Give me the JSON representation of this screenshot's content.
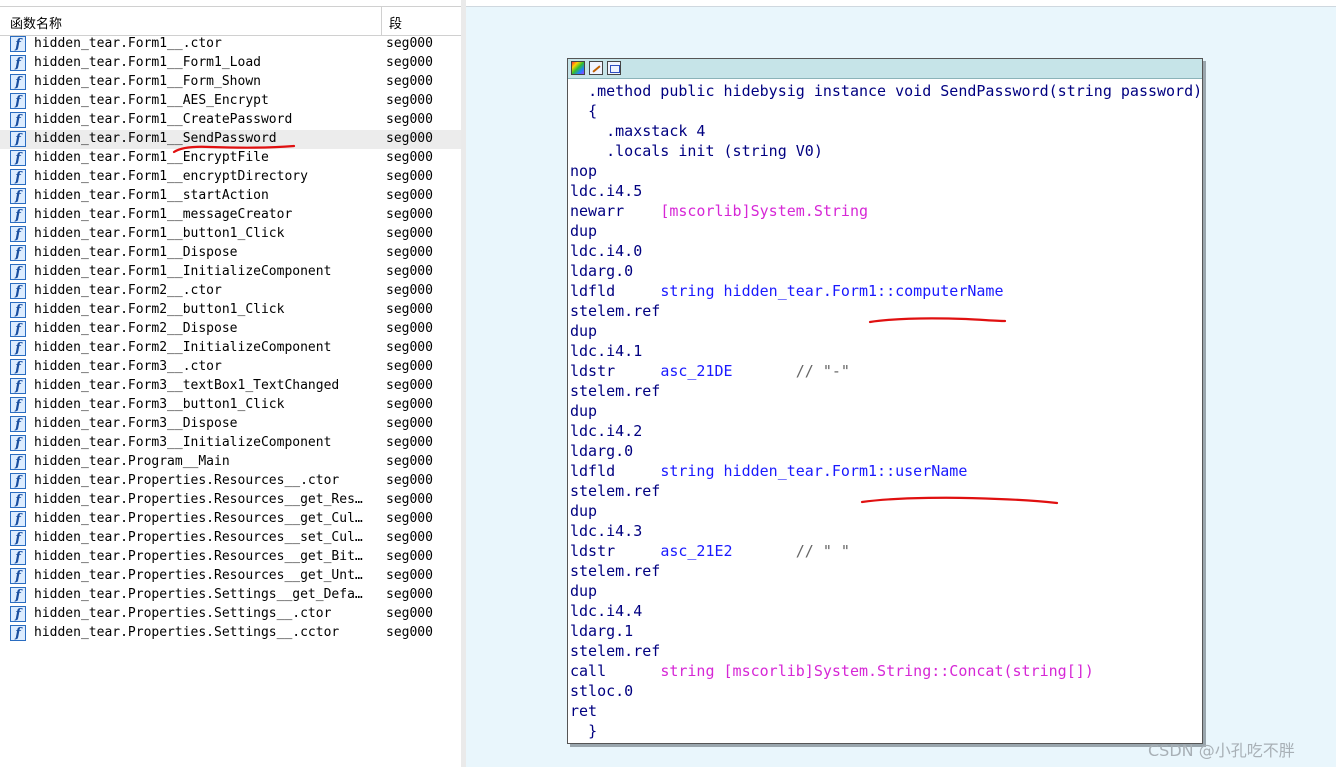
{
  "function_list": {
    "header": {
      "name_col": "函数名称",
      "segment_col": "段"
    },
    "icon_glyph": "f",
    "rows": [
      {
        "name": "hidden_tear.Form1__.ctor",
        "segment": "seg000"
      },
      {
        "name": "hidden_tear.Form1__Form1_Load",
        "segment": "seg000"
      },
      {
        "name": "hidden_tear.Form1__Form_Shown",
        "segment": "seg000"
      },
      {
        "name": "hidden_tear.Form1__AES_Encrypt",
        "segment": "seg000"
      },
      {
        "name": "hidden_tear.Form1__CreatePassword",
        "segment": "seg000"
      },
      {
        "name": "hidden_tear.Form1__SendPassword",
        "segment": "seg000",
        "selected": true
      },
      {
        "name": "hidden_tear.Form1__EncryptFile",
        "segment": "seg000"
      },
      {
        "name": "hidden_tear.Form1__encryptDirectory",
        "segment": "seg000"
      },
      {
        "name": "hidden_tear.Form1__startAction",
        "segment": "seg000"
      },
      {
        "name": "hidden_tear.Form1__messageCreator",
        "segment": "seg000"
      },
      {
        "name": "hidden_tear.Form1__button1_Click",
        "segment": "seg000"
      },
      {
        "name": "hidden_tear.Form1__Dispose",
        "segment": "seg000"
      },
      {
        "name": "hidden_tear.Form1__InitializeComponent",
        "segment": "seg000"
      },
      {
        "name": "hidden_tear.Form2__.ctor",
        "segment": "seg000"
      },
      {
        "name": "hidden_tear.Form2__button1_Click",
        "segment": "seg000"
      },
      {
        "name": "hidden_tear.Form2__Dispose",
        "segment": "seg000"
      },
      {
        "name": "hidden_tear.Form2__InitializeComponent",
        "segment": "seg000"
      },
      {
        "name": "hidden_tear.Form3__.ctor",
        "segment": "seg000"
      },
      {
        "name": "hidden_tear.Form3__textBox1_TextChanged",
        "segment": "seg000"
      },
      {
        "name": "hidden_tear.Form3__button1_Click",
        "segment": "seg000"
      },
      {
        "name": "hidden_tear.Form3__Dispose",
        "segment": "seg000"
      },
      {
        "name": "hidden_tear.Form3__InitializeComponent",
        "segment": "seg000"
      },
      {
        "name": "hidden_tear.Program__Main",
        "segment": "seg000"
      },
      {
        "name": "hidden_tear.Properties.Resources__.ctor",
        "segment": "seg000"
      },
      {
        "name": "hidden_tear.Properties.Resources__get_Res…",
        "segment": "seg000"
      },
      {
        "name": "hidden_tear.Properties.Resources__get_Cul…",
        "segment": "seg000"
      },
      {
        "name": "hidden_tear.Properties.Resources__set_Cul…",
        "segment": "seg000"
      },
      {
        "name": "hidden_tear.Properties.Resources__get_Bit…",
        "segment": "seg000"
      },
      {
        "name": "hidden_tear.Properties.Resources__get_Unt…",
        "segment": "seg000"
      },
      {
        "name": "hidden_tear.Properties.Settings__get_Defa…",
        "segment": "seg000"
      },
      {
        "name": "hidden_tear.Properties.Settings__.ctor",
        "segment": "seg000"
      },
      {
        "name": "hidden_tear.Properties.Settings__.cctor",
        "segment": "seg000"
      }
    ]
  },
  "code_view": {
    "lines": [
      {
        "indent": "  ",
        "op": ".method public hidebysig instance void SendPassword(string password)",
        "arg": "",
        "arg_color": "blue",
        "comment": ""
      },
      {
        "indent": "  ",
        "op": "{",
        "arg": "",
        "arg_color": "blue",
        "comment": ""
      },
      {
        "indent": "    ",
        "op": ".maxstack 4",
        "arg": "",
        "arg_color": "blue",
        "comment": ""
      },
      {
        "indent": "    ",
        "op": ".locals init (string V0)",
        "arg": "",
        "arg_color": "blue",
        "comment": ""
      },
      {
        "indent": "",
        "op": "nop",
        "arg": "",
        "arg_color": "blue",
        "comment": ""
      },
      {
        "indent": "",
        "op": "ldc.i4.5",
        "arg": "",
        "arg_color": "blue",
        "comment": ""
      },
      {
        "indent": "",
        "op": "newarr",
        "arg": "[mscorlib]System.String",
        "arg_color": "pink",
        "comment": ""
      },
      {
        "indent": "",
        "op": "dup",
        "arg": "",
        "arg_color": "blue",
        "comment": ""
      },
      {
        "indent": "",
        "op": "ldc.i4.0",
        "arg": "",
        "arg_color": "blue",
        "comment": ""
      },
      {
        "indent": "",
        "op": "ldarg.0",
        "arg": "",
        "arg_color": "blue",
        "comment": ""
      },
      {
        "indent": "",
        "op": "ldfld",
        "arg": "string hidden_tear.Form1::computerName",
        "arg_color": "blue",
        "comment": ""
      },
      {
        "indent": "",
        "op": "stelem.ref",
        "arg": "",
        "arg_color": "blue",
        "comment": ""
      },
      {
        "indent": "",
        "op": "dup",
        "arg": "",
        "arg_color": "blue",
        "comment": ""
      },
      {
        "indent": "",
        "op": "ldc.i4.1",
        "arg": "",
        "arg_color": "blue",
        "comment": ""
      },
      {
        "indent": "",
        "op": "ldstr",
        "arg": "asc_21DE",
        "arg_color": "str",
        "comment": "// \"-\""
      },
      {
        "indent": "",
        "op": "stelem.ref",
        "arg": "",
        "arg_color": "blue",
        "comment": ""
      },
      {
        "indent": "",
        "op": "dup",
        "arg": "",
        "arg_color": "blue",
        "comment": ""
      },
      {
        "indent": "",
        "op": "ldc.i4.2",
        "arg": "",
        "arg_color": "blue",
        "comment": ""
      },
      {
        "indent": "",
        "op": "ldarg.0",
        "arg": "",
        "arg_color": "blue",
        "comment": ""
      },
      {
        "indent": "",
        "op": "ldfld",
        "arg": "string hidden_tear.Form1::userName",
        "arg_color": "blue",
        "comment": ""
      },
      {
        "indent": "",
        "op": "stelem.ref",
        "arg": "",
        "arg_color": "blue",
        "comment": ""
      },
      {
        "indent": "",
        "op": "dup",
        "arg": "",
        "arg_color": "blue",
        "comment": ""
      },
      {
        "indent": "",
        "op": "ldc.i4.3",
        "arg": "",
        "arg_color": "blue",
        "comment": ""
      },
      {
        "indent": "",
        "op": "ldstr",
        "arg": "asc_21E2",
        "arg_color": "str",
        "comment": "// \" \""
      },
      {
        "indent": "",
        "op": "stelem.ref",
        "arg": "",
        "arg_color": "blue",
        "comment": ""
      },
      {
        "indent": "",
        "op": "dup",
        "arg": "",
        "arg_color": "blue",
        "comment": ""
      },
      {
        "indent": "",
        "op": "ldc.i4.4",
        "arg": "",
        "arg_color": "blue",
        "comment": ""
      },
      {
        "indent": "",
        "op": "ldarg.1",
        "arg": "",
        "arg_color": "blue",
        "comment": ""
      },
      {
        "indent": "",
        "op": "stelem.ref",
        "arg": "",
        "arg_color": "blue",
        "comment": ""
      },
      {
        "indent": "",
        "op": "call",
        "arg": "string [mscorlib]System.String::Concat(string[])",
        "arg_color": "pink",
        "comment": ""
      },
      {
        "indent": "",
        "op": "stloc.0",
        "arg": "",
        "arg_color": "blue",
        "comment": ""
      },
      {
        "indent": "",
        "op": "ret",
        "arg": "",
        "arg_color": "blue",
        "comment": ""
      },
      {
        "indent": "  ",
        "op": "}",
        "arg": "",
        "arg_color": "blue",
        "comment": ""
      }
    ]
  },
  "watermark": "CSDN @小孔吃不胖",
  "colors": {
    "annotation_red": "#e01010",
    "graph_background": "#e9f6fc",
    "node_titlebar": "#c6e4e8"
  }
}
